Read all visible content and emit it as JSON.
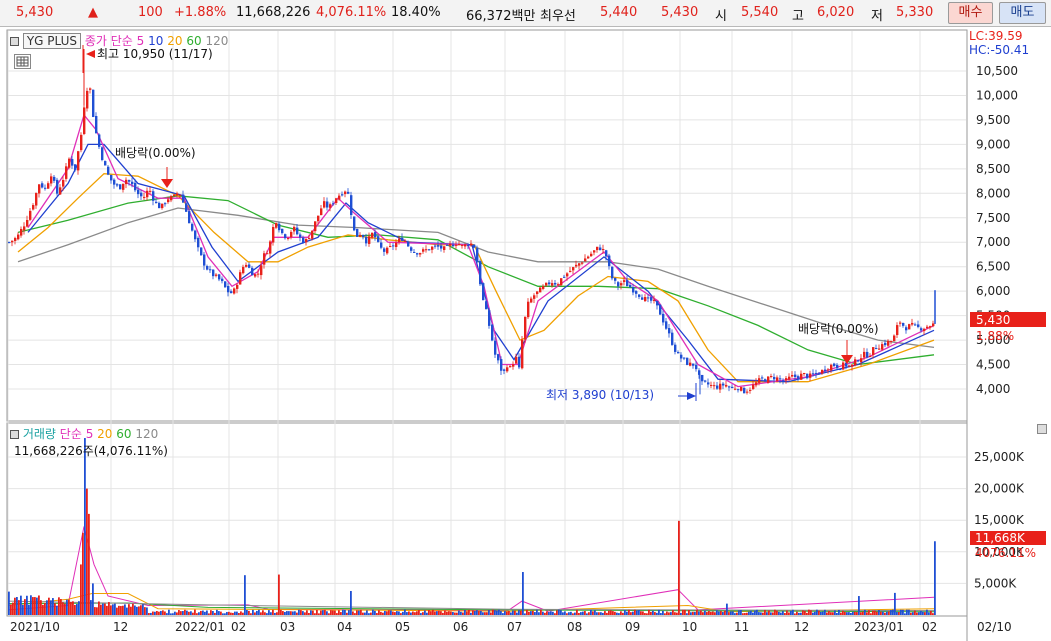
{
  "quote": {
    "price": "5,430",
    "arrow": "▲",
    "change": "100",
    "change_pct": "+1.88%",
    "volume": "11,668,226",
    "volume_ratio": "4,076.11%",
    "turnover": "18.40%",
    "amount": "66,372백만",
    "best_label": "최우선",
    "best_ask": "5,440",
    "best_bid": "5,430",
    "open_label": "시",
    "open": "5,540",
    "high_label": "고",
    "high": "6,020",
    "low_label": "저",
    "low": "5,330",
    "buy_label": "매수",
    "sell_label": "매도"
  },
  "price_panel": {
    "stock_name": "YG PLUS",
    "ma_title": "종가 단순",
    "ma_periods": [
      "5",
      "10",
      "20",
      "60",
      "120"
    ],
    "lc": "LC:39.59",
    "hc": "HC:-50.41",
    "high_note": "최고 10,950 (11/17)",
    "low_note": "최저 3,890 (10/13)",
    "div1": "배당락(0.00%)",
    "div2": "배당락(0.00%)",
    "price_tag": "5,430",
    "pct_tag": "1.88%"
  },
  "volume_panel": {
    "title": "거래량",
    "ma_title": "단순",
    "ma_periods": [
      "5",
      "20",
      "60",
      "120"
    ],
    "info": "11,668,226주(4,076.11%)",
    "vol_tag": "11,668K",
    "vol_pct_tag": "4076.11%"
  },
  "colors": {
    "up": "#e8211a",
    "down": "#1f4fd4",
    "ma5": "#e02fb8",
    "ma10": "#2040d0",
    "ma20": "#f0a000",
    "ma60": "#2fae2f",
    "ma120": "#8a8a8a"
  },
  "chart_data": [
    {
      "type": "candlestick",
      "title": "YG PLUS",
      "y_ticks": [
        "10,500",
        "10,000",
        "9,500",
        "9,000",
        "8,500",
        "8,000",
        "7,500",
        "7,000",
        "6,500",
        "6,000",
        "5,500",
        "5,000",
        "4,500",
        "4,000"
      ],
      "ylim": [
        3700,
        10900
      ],
      "x_ticks": [
        "2021/10",
        "12",
        "2022/01",
        "02",
        "03",
        "04",
        "05",
        "06",
        "07",
        "08",
        "09",
        "10",
        "11",
        "12",
        "2023/01",
        "02",
        "02/10"
      ],
      "close_path": [
        [
          0,
          7000
        ],
        [
          8,
          7100
        ],
        [
          16,
          7400
        ],
        [
          24,
          7800
        ],
        [
          30,
          8200
        ],
        [
          36,
          8100
        ],
        [
          42,
          8400
        ],
        [
          48,
          8000
        ],
        [
          54,
          8300
        ],
        [
          60,
          8700
        ],
        [
          66,
          8500
        ],
        [
          72,
          9200
        ],
        [
          76,
          10000
        ],
        [
          80,
          10300
        ],
        [
          84,
          9600
        ],
        [
          88,
          9100
        ],
        [
          92,
          8800
        ],
        [
          98,
          8400
        ],
        [
          104,
          8200
        ],
        [
          110,
          8100
        ],
        [
          116,
          8300
        ],
        [
          122,
          8200
        ],
        [
          128,
          8000
        ],
        [
          134,
          7900
        ],
        [
          140,
          8100
        ],
        [
          146,
          7800
        ],
        [
          152,
          7700
        ],
        [
          158,
          7900
        ],
        [
          164,
          7900
        ],
        [
          170,
          8050
        ],
        [
          176,
          7700
        ],
        [
          182,
          7300
        ],
        [
          188,
          6900
        ],
        [
          194,
          6600
        ],
        [
          200,
          6400
        ],
        [
          206,
          6300
        ],
        [
          212,
          6200
        ],
        [
          218,
          6000
        ],
        [
          224,
          5950
        ],
        [
          230,
          6300
        ],
        [
          236,
          6600
        ],
        [
          242,
          6400
        ],
        [
          248,
          6300
        ],
        [
          254,
          6700
        ],
        [
          260,
          6900
        ],
        [
          266,
          7500
        ],
        [
          272,
          7200
        ],
        [
          278,
          7100
        ],
        [
          284,
          7300
        ],
        [
          290,
          7100
        ],
        [
          296,
          7000
        ],
        [
          302,
          7200
        ],
        [
          308,
          7500
        ],
        [
          314,
          7800
        ],
        [
          320,
          7700
        ],
        [
          326,
          7900
        ],
        [
          332,
          8000
        ],
        [
          338,
          8100
        ],
        [
          342,
          7600
        ],
        [
          346,
          7100
        ],
        [
          352,
          7200
        ],
        [
          358,
          7000
        ],
        [
          364,
          7200
        ],
        [
          370,
          6900
        ],
        [
          376,
          6800
        ],
        [
          382,
          6900
        ],
        [
          388,
          7000
        ],
        [
          394,
          7100
        ],
        [
          400,
          6900
        ],
        [
          406,
          6800
        ],
        [
          412,
          6800
        ],
        [
          418,
          6850
        ],
        [
          424,
          6900
        ],
        [
          430,
          6900
        ],
        [
          436,
          6850
        ],
        [
          442,
          6950
        ],
        [
          448,
          7000
        ],
        [
          454,
          6900
        ],
        [
          460,
          7000
        ],
        [
          466,
          6900
        ],
        [
          470,
          6300
        ],
        [
          474,
          5800
        ],
        [
          478,
          5500
        ],
        [
          482,
          5100
        ],
        [
          486,
          4700
        ],
        [
          490,
          4500
        ],
        [
          494,
          4300
        ],
        [
          498,
          4500
        ],
        [
          502,
          4400
        ],
        [
          506,
          4700
        ],
        [
          510,
          4400
        ],
        [
          514,
          5200
        ],
        [
          518,
          5700
        ],
        [
          524,
          5900
        ],
        [
          530,
          6000
        ],
        [
          536,
          6100
        ],
        [
          542,
          6200
        ],
        [
          548,
          6150
        ],
        [
          554,
          6300
        ],
        [
          560,
          6400
        ],
        [
          566,
          6500
        ],
        [
          572,
          6600
        ],
        [
          578,
          6700
        ],
        [
          584,
          6800
        ],
        [
          590,
          6900
        ],
        [
          596,
          6800
        ],
        [
          602,
          6300
        ],
        [
          608,
          6100
        ],
        [
          614,
          6200
        ],
        [
          620,
          6100
        ],
        [
          626,
          6000
        ],
        [
          632,
          5900
        ],
        [
          638,
          5800
        ],
        [
          644,
          5800
        ],
        [
          650,
          5600
        ],
        [
          656,
          5300
        ],
        [
          662,
          5000
        ],
        [
          668,
          4700
        ],
        [
          674,
          4600
        ],
        [
          680,
          4500
        ],
        [
          686,
          4500
        ],
        [
          692,
          4100
        ],
        [
          698,
          4100
        ],
        [
          704,
          4050
        ],
        [
          710,
          4050
        ],
        [
          716,
          4100
        ],
        [
          722,
          4000
        ],
        [
          728,
          4050
        ],
        [
          734,
          3950
        ],
        [
          740,
          4000
        ],
        [
          746,
          4100
        ],
        [
          752,
          4200
        ],
        [
          758,
          4200
        ],
        [
          764,
          4250
        ],
        [
          770,
          4200
        ],
        [
          776,
          4150
        ],
        [
          782,
          4250
        ],
        [
          788,
          4250
        ],
        [
          794,
          4300
        ],
        [
          800,
          4250
        ],
        [
          806,
          4300
        ],
        [
          812,
          4350
        ],
        [
          818,
          4450
        ],
        [
          824,
          4500
        ],
        [
          830,
          4450
        ],
        [
          836,
          4500
        ],
        [
          842,
          4450
        ],
        [
          848,
          4600
        ],
        [
          854,
          4700
        ],
        [
          860,
          4700
        ],
        [
          866,
          4850
        ],
        [
          872,
          4900
        ],
        [
          878,
          4950
        ],
        [
          884,
          5000
        ],
        [
          890,
          5400
        ],
        [
          896,
          5250
        ],
        [
          902,
          5300
        ],
        [
          908,
          5250
        ],
        [
          914,
          5250
        ],
        [
          920,
          5300
        ],
        [
          926,
          5330
        ]
      ],
      "ma5_path": [
        [
          20,
          7300
        ],
        [
          60,
          8500
        ],
        [
          76,
          9600
        ],
        [
          88,
          9300
        ],
        [
          110,
          8300
        ],
        [
          150,
          7900
        ],
        [
          176,
          7900
        ],
        [
          200,
          6700
        ],
        [
          224,
          6100
        ],
        [
          250,
          6400
        ],
        [
          266,
          7100
        ],
        [
          300,
          7100
        ],
        [
          330,
          7900
        ],
        [
          346,
          7600
        ],
        [
          380,
          7000
        ],
        [
          460,
          6950
        ],
        [
          476,
          6100
        ],
        [
          494,
          4500
        ],
        [
          510,
          4500
        ],
        [
          530,
          5800
        ],
        [
          596,
          6800
        ],
        [
          620,
          6200
        ],
        [
          650,
          5800
        ],
        [
          690,
          4500
        ],
        [
          730,
          4050
        ],
        [
          800,
          4250
        ],
        [
          860,
          4650
        ],
        [
          926,
          5300
        ]
      ],
      "ma10_path": [
        [
          20,
          7200
        ],
        [
          60,
          8200
        ],
        [
          80,
          9000
        ],
        [
          96,
          9000
        ],
        [
          130,
          8200
        ],
        [
          176,
          7950
        ],
        [
          204,
          6900
        ],
        [
          230,
          6200
        ],
        [
          270,
          6800
        ],
        [
          310,
          7100
        ],
        [
          338,
          7800
        ],
        [
          360,
          7400
        ],
        [
          400,
          7000
        ],
        [
          464,
          6950
        ],
        [
          486,
          5200
        ],
        [
          506,
          4600
        ],
        [
          540,
          5800
        ],
        [
          596,
          6700
        ],
        [
          640,
          6000
        ],
        [
          680,
          5000
        ],
        [
          710,
          4200
        ],
        [
          780,
          4150
        ],
        [
          850,
          4500
        ],
        [
          926,
          5200
        ]
      ],
      "ma20_path": [
        [
          10,
          6800
        ],
        [
          40,
          7300
        ],
        [
          70,
          7900
        ],
        [
          96,
          8400
        ],
        [
          130,
          8350
        ],
        [
          170,
          7950
        ],
        [
          206,
          7200
        ],
        [
          240,
          6600
        ],
        [
          270,
          6600
        ],
        [
          300,
          6900
        ],
        [
          340,
          7150
        ],
        [
          380,
          7050
        ],
        [
          430,
          6950
        ],
        [
          466,
          6950
        ],
        [
          488,
          6000
        ],
        [
          512,
          5000
        ],
        [
          536,
          5200
        ],
        [
          570,
          5900
        ],
        [
          600,
          6300
        ],
        [
          640,
          6200
        ],
        [
          670,
          5800
        ],
        [
          700,
          4800
        ],
        [
          730,
          4150
        ],
        [
          800,
          4150
        ],
        [
          860,
          4500
        ],
        [
          926,
          5000
        ]
      ],
      "ma60_path": [
        [
          10,
          7200
        ],
        [
          60,
          7450
        ],
        [
          120,
          7800
        ],
        [
          170,
          7950
        ],
        [
          220,
          7850
        ],
        [
          270,
          7350
        ],
        [
          320,
          7100
        ],
        [
          370,
          7150
        ],
        [
          430,
          7050
        ],
        [
          480,
          6500
        ],
        [
          530,
          6100
        ],
        [
          590,
          6100
        ],
        [
          650,
          6050
        ],
        [
          700,
          5700
        ],
        [
          750,
          5300
        ],
        [
          800,
          4800
        ],
        [
          850,
          4500
        ],
        [
          926,
          4700
        ]
      ],
      "ma120_path": [
        [
          10,
          6600
        ],
        [
          60,
          6950
        ],
        [
          120,
          7400
        ],
        [
          170,
          7700
        ],
        [
          230,
          7550
        ],
        [
          290,
          7350
        ],
        [
          350,
          7300
        ],
        [
          430,
          7200
        ],
        [
          480,
          6800
        ],
        [
          530,
          6600
        ],
        [
          600,
          6600
        ],
        [
          650,
          6450
        ],
        [
          700,
          6100
        ],
        [
          760,
          5700
        ],
        [
          820,
          5300
        ],
        [
          870,
          5000
        ],
        [
          926,
          4850
        ]
      ]
    },
    {
      "type": "bar",
      "title": "거래량",
      "y_ticks": [
        "25,000K",
        "20,000K",
        "15,000K",
        "10,000K",
        "5,000K"
      ],
      "ylim": [
        0,
        28000
      ],
      "spikes": [
        [
          72,
          8000
        ],
        [
          74,
          13000
        ],
        [
          76,
          28000
        ],
        [
          78,
          20000
        ],
        [
          80,
          16000
        ],
        [
          84,
          5000
        ],
        [
          236,
          6300
        ],
        [
          270,
          6400
        ],
        [
          342,
          3800
        ],
        [
          514,
          6800
        ],
        [
          670,
          14900
        ],
        [
          718,
          1800
        ],
        [
          850,
          3000
        ],
        [
          886,
          3500
        ],
        [
          926,
          11668
        ]
      ]
    }
  ]
}
